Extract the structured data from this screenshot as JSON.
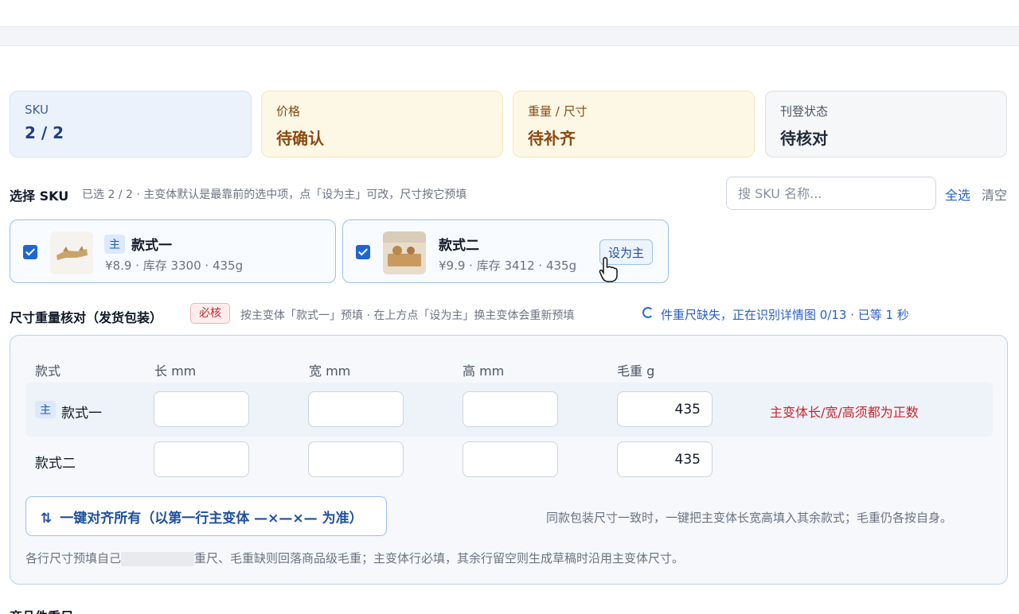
{
  "stats": [
    {
      "label": "SKU",
      "value": "2 / 2"
    },
    {
      "label": "价格",
      "value": "待确认"
    },
    {
      "label": "重量 / 尺寸",
      "value": "待补齐"
    },
    {
      "label": "刊登状态",
      "value": "待核对"
    }
  ],
  "sku_select": {
    "title": "选择 SKU",
    "hint": "已选 2 / 2 · 主变体默认是最靠前的选中项，点「设为主」可改，尺寸按它预填",
    "search_placeholder": "搜 SKU 名称...",
    "select_all": "全选",
    "clear": "清空",
    "cards": [
      {
        "main_tag": "主",
        "name": "款式一",
        "meta": "¥8.9 · 库存 3300 · 435g",
        "checked": true
      },
      {
        "name": "款式二",
        "meta": "¥9.9 · 库存 3412 · 435g",
        "set_main_label": "设为主",
        "checked": true
      }
    ]
  },
  "size_check": {
    "title": "尺寸重量核对（发货包装）",
    "must_badge": "必核",
    "hint": "按主变体「款式一」预填 · 在上方点「设为主」换主变体会重新预填",
    "status": "件重尺缺失，正在识别详情图 0/13 · 已等 1 秒",
    "headers": [
      "款式",
      "长 mm",
      "宽 mm",
      "高 mm",
      "毛重 g"
    ],
    "rows": [
      {
        "tag": "主",
        "name": "款式一",
        "length": "",
        "width": "",
        "height": "",
        "weight": "435",
        "error": "主变体长/宽/高须都为正数"
      },
      {
        "name": "款式二",
        "length": "",
        "width": "",
        "height": "",
        "weight": "435"
      }
    ],
    "align_button": "一键对齐所有（以第一行主变体 —×—×— 为准）",
    "align_icon": "sort-arrows-icon",
    "align_hint": "同款包装尺寸一致时，一键把主变体长宽高填入其余款式；毛重仍各按自身。",
    "footnote_left": "各行尺寸预填自己",
    "footnote_right": "重尺、毛重缺则回落商品级毛重；主变体行必填，其余行留空则生成草稿时沿用主变体尺寸。"
  },
  "next_section_partial": "商品件重尺"
}
